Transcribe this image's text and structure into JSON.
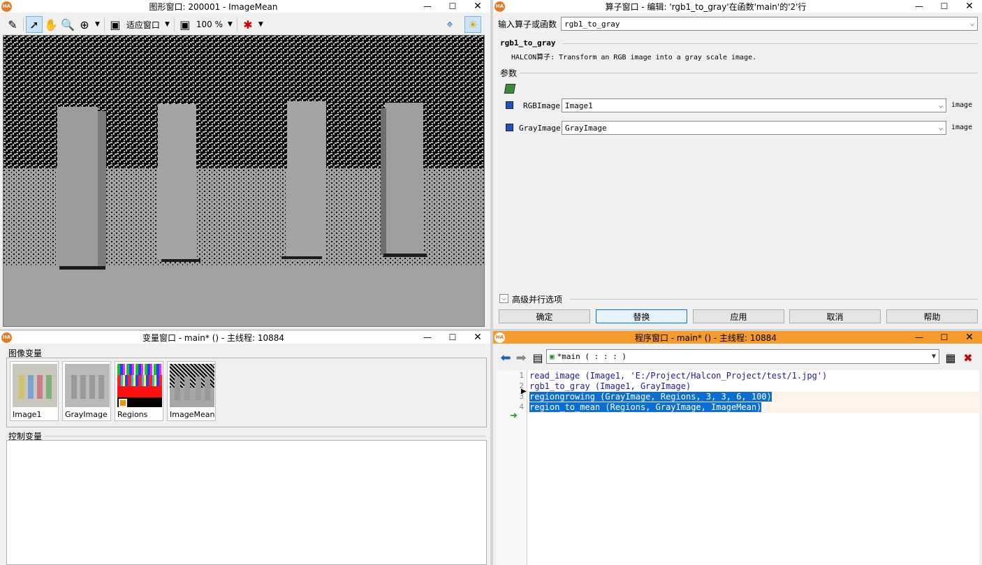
{
  "graphics_window": {
    "title": "图形窗口: 200001 - ImageMean",
    "fit_label": "适应窗口",
    "zoom_value": "100 %"
  },
  "operator_window": {
    "title": "算子窗口 - 编辑: 'rgb1_to_gray'在函数'main'的'2'行",
    "input_label": "输入算子或函数",
    "input_value": "rgb1_to_gray",
    "operator_name": "rgb1_to_gray",
    "description": "HALCON算子: Transform an RGB image into a gray scale image.",
    "params_label": "参数",
    "params": [
      {
        "name": "RGBImage",
        "value": "Image1",
        "type": "image"
      },
      {
        "name": "GrayImage",
        "value": "GrayImage",
        "type": "image"
      }
    ],
    "advanced_label": "高级并行选项",
    "buttons": {
      "ok": "确定",
      "replace": "替换",
      "apply": "应用",
      "cancel": "取消",
      "help": "帮助"
    }
  },
  "variable_window": {
    "title": "变量窗口 - main* () - 主线程: 10884",
    "image_vars_label": "图像变量",
    "control_vars_label": "控制变量",
    "image_vars": [
      "Image1",
      "GrayImage",
      "Regions",
      "ImageMean"
    ]
  },
  "program_window": {
    "title": "程序窗口 - main* () - 主线程: 10884",
    "procedure": "*main ( : : : )",
    "lines": [
      {
        "num": "1",
        "text": "read_image (Image1, 'E:/Project/Halcon_Project/test/1.jpg')"
      },
      {
        "num": "2",
        "text": "rgb1_to_gray (Image1, GrayImage)"
      },
      {
        "num": "3",
        "text": "regiongrowing (GrayImage, Regions, 3, 3, 6, 100)"
      },
      {
        "num": "4",
        "text": "region_to_mean (Regions, GrayImage, ImageMean)"
      }
    ]
  },
  "window_controls": {
    "minimize": "—",
    "maximize": "☐",
    "close": "✕"
  },
  "colors": {
    "title_orange": "#f59a2c",
    "selection_blue": "#0a6fd0",
    "code_blue": "#1a1aa0"
  }
}
